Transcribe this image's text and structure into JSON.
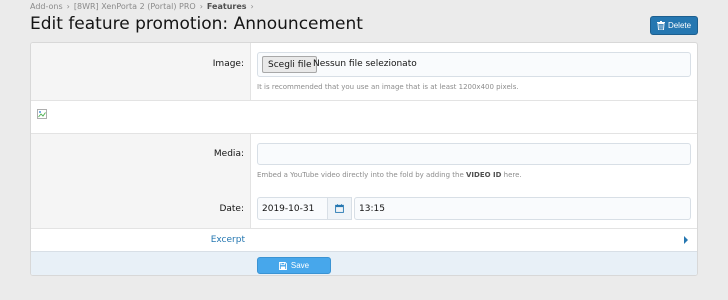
{
  "breadcrumb": {
    "items": [
      "Add-ons",
      "[8WR] XenPorta 2 (Portal) PRO",
      "Features"
    ]
  },
  "page": {
    "title": "Edit feature promotion: Announcement",
    "delete_label": "Delete"
  },
  "form": {
    "image": {
      "label": "Image:",
      "file_button": "Scegli file",
      "file_status": "Nessun file selezionato",
      "hint": "It is recommended that you use an image that is at least 1200x400 pixels."
    },
    "media": {
      "label": "Media:",
      "value": "",
      "hint_before": "Embed a YouTube video directly into the fold by adding the ",
      "hint_bold": "VIDEO ID",
      "hint_after": " here."
    },
    "date": {
      "label": "Date:",
      "date_value": "2019-10-31",
      "time_value": "13:15"
    },
    "excerpt": {
      "label": "Excerpt",
      "expanded": false
    },
    "save_label": "Save"
  },
  "colors": {
    "accent": "#2577b1",
    "save_button": "#47a7eb",
    "background": "#ebebeb"
  },
  "icons": {
    "delete": "trash-icon",
    "calendar": "calendar-icon",
    "save": "floppy-disk-icon",
    "excerpt_toggle": "chevron-right-icon",
    "broken_image": "broken-image-icon"
  }
}
